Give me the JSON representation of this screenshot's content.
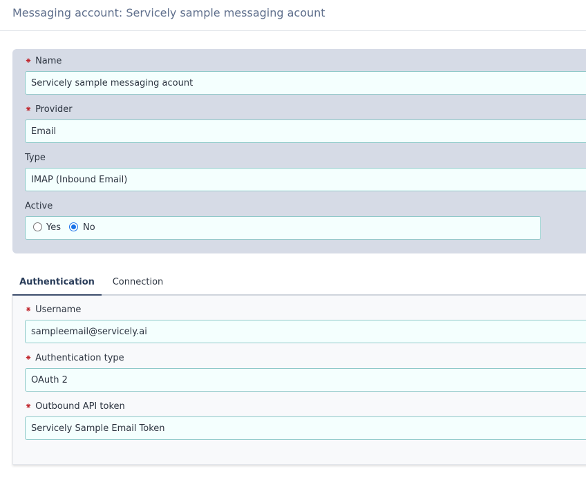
{
  "header": {
    "title": "Messaging account: Servicely sample messaging acount"
  },
  "form": {
    "required_marker": "⁕",
    "name": {
      "label": "Name",
      "value": "Servicely sample messaging acount"
    },
    "provider": {
      "label": "Provider",
      "value": "Email"
    },
    "type": {
      "label": "Type",
      "value": "IMAP (Inbound Email)"
    },
    "active": {
      "label": "Active",
      "options": [
        "Yes",
        "No"
      ],
      "selected": "No"
    }
  },
  "tabs": [
    {
      "label": "Authentication",
      "active": true
    },
    {
      "label": "Connection",
      "active": false
    }
  ],
  "authentication": {
    "username": {
      "label": "Username",
      "value": "sampleemail@servicely.ai"
    },
    "auth_type": {
      "label": "Authentication type",
      "value": "OAuth 2"
    },
    "api_token": {
      "label": "Outbound API token",
      "value": "Servicely Sample Email Token"
    }
  },
  "colors": {
    "required": "#c0242b",
    "panel": "#d6dbe6",
    "input_border": "#8fc9c9",
    "radio_accent": "#1a73e8"
  }
}
